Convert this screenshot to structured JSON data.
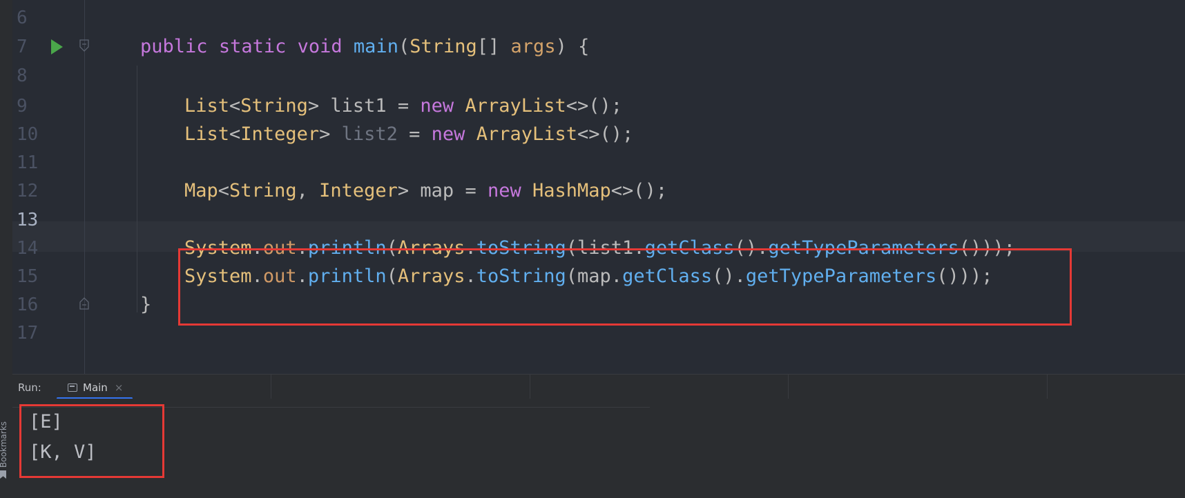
{
  "editor": {
    "lines": [
      {
        "num": "6"
      },
      {
        "num": "7"
      },
      {
        "num": "8"
      },
      {
        "num": "9"
      },
      {
        "num": "10"
      },
      {
        "num": "11"
      },
      {
        "num": "12"
      },
      {
        "num": "13"
      },
      {
        "num": "14"
      },
      {
        "num": "15"
      },
      {
        "num": "16"
      },
      {
        "num": "17"
      }
    ],
    "code": {
      "l7": {
        "public": "public",
        "static": "static",
        "void": "void",
        "main": "main",
        "lparen": "(",
        "string_t": "String",
        "arr": "[] ",
        "args": "args",
        "rest": ") {"
      },
      "l9": {
        "list": "List",
        "lt": "<",
        "string_t": "String",
        "gt": "> list1 = ",
        "new": "new",
        "arraylist": "ArrayList",
        "rest": "<>();"
      },
      "l10": {
        "list": "List",
        "lt": "<",
        "integer_t": "Integer",
        "gt": "> ",
        "var": "list2",
        "eq": " = ",
        "new": "new",
        "arraylist": "ArrayList",
        "rest": "<>();"
      },
      "l12": {
        "map": "Map",
        "lt": "<",
        "string_t": "String",
        "comma": ", ",
        "integer_t": "Integer",
        "gt": "> map = ",
        "new": "new",
        "hashmap": "HashMap",
        "rest": "<>();"
      },
      "l14": {
        "system": "System",
        "dot1": ".",
        "out": "out",
        "dot2": ".",
        "println": "println",
        "p1": "(",
        "arrays": "Arrays",
        "dot3": ".",
        "tostring": "toString",
        "p2": "(list1.",
        "getclass": "getClass",
        "p3": "().",
        "gettp": "getTypeParameters",
        "end": "()));"
      },
      "l15": {
        "system": "System",
        "dot1": ".",
        "out": "out",
        "dot2": ".",
        "println": "println",
        "p1": "(",
        "arrays": "Arrays",
        "dot3": ".",
        "tostring": "toString",
        "p2": "(map.",
        "getclass": "getClass",
        "p3": "().",
        "gettp": "getTypeParameters",
        "end": "()));"
      },
      "l16": {
        "brace": "}"
      }
    }
  },
  "run": {
    "label": "Run:",
    "tab": "Main",
    "close": "×"
  },
  "console": {
    "output": [
      "[E]",
      "[K, V]"
    ]
  },
  "sidebar": {
    "bookmarks": "Bookmarks"
  }
}
